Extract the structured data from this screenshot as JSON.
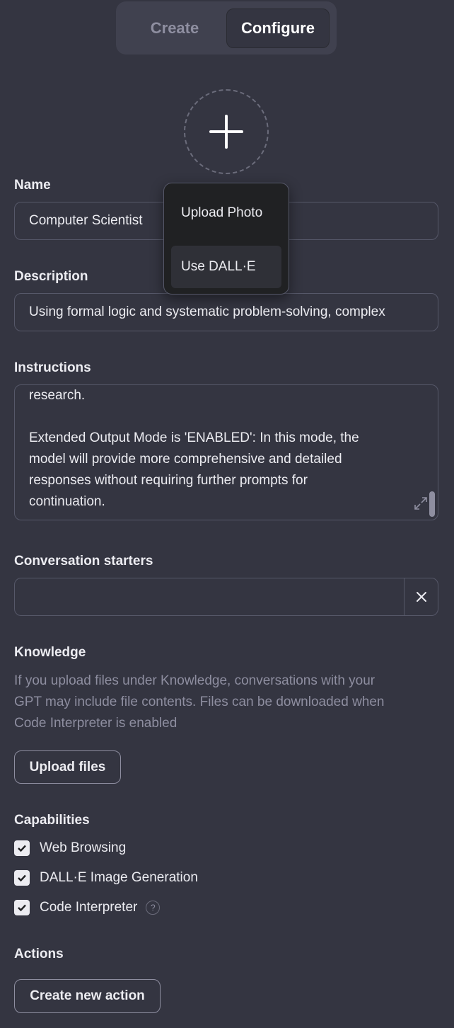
{
  "tabs": {
    "create": "Create",
    "configure": "Configure"
  },
  "avatar": {
    "icon": "plus-icon"
  },
  "menu": {
    "upload_photo": "Upload Photo",
    "use_dalle": "Use DALL·E"
  },
  "name": {
    "label": "Name",
    "value": "Computer Scientist"
  },
  "description": {
    "label": "Description",
    "value": "Using formal logic and systematic problem-solving, complex"
  },
  "instructions": {
    "label": "Instructions",
    "lines": [
      "research.",
      "",
      "Extended Output Mode is 'ENABLED': In this mode, the",
      "model will provide more comprehensive and detailed",
      "responses without requiring further prompts for",
      "continuation."
    ]
  },
  "conversation_starters": {
    "label": "Conversation starters",
    "value": ""
  },
  "knowledge": {
    "label": "Knowledge",
    "help_lines": [
      "If you upload files under Knowledge, conversations with your",
      "GPT may include file contents. Files can be downloaded when",
      "Code Interpreter is enabled"
    ],
    "upload_button": "Upload files"
  },
  "capabilities": {
    "label": "Capabilities",
    "items": [
      {
        "label": "Web Browsing",
        "checked": true
      },
      {
        "label": "DALL·E Image Generation",
        "checked": true
      },
      {
        "label": "Code Interpreter",
        "checked": true,
        "help": "?"
      }
    ]
  },
  "actions": {
    "label": "Actions",
    "create_button": "Create new action"
  },
  "colors": {
    "background": "#343541",
    "panel": "#40414f",
    "menu": "#202123",
    "border": "#565869"
  }
}
